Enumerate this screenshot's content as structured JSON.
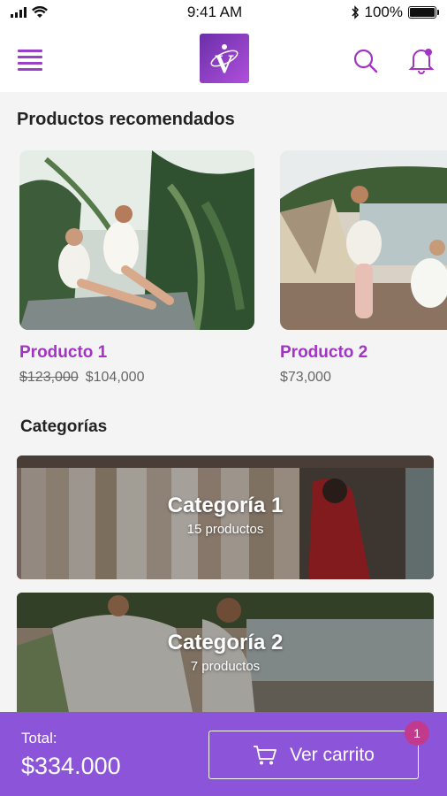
{
  "status_bar": {
    "time": "9:41 AM",
    "battery": "100%"
  },
  "header": {
    "logo_letter": "V"
  },
  "recommended": {
    "title": "Productos recomendados",
    "products": [
      {
        "name": "Producto 1",
        "old_price": "$123,000",
        "price": "$104,000"
      },
      {
        "name": "Producto 2",
        "price": "$73,000"
      }
    ]
  },
  "categories": {
    "title": "Categorías",
    "items": [
      {
        "name": "Categoría 1",
        "count": "15 productos"
      },
      {
        "name": "Categoría 2",
        "count": "7 productos"
      }
    ]
  },
  "footer": {
    "total_label": "Total:",
    "total_value": "$334.000",
    "cart_label": "Ver carrito",
    "cart_count": "1"
  },
  "colors": {
    "accent": "#a234c4",
    "footer": "#8c55d9",
    "badge": "#c23a8e"
  }
}
